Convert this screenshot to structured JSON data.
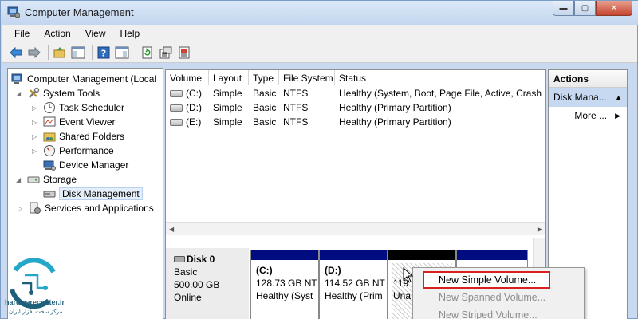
{
  "window": {
    "title": "Computer Management",
    "controls": [
      "minimize",
      "maximize",
      "close"
    ]
  },
  "menu": [
    "File",
    "Action",
    "View",
    "Help"
  ],
  "toolbar_icons": [
    "back-arrow-icon",
    "forward-arrow-icon",
    "up-folder-icon",
    "show-hide-tree-icon",
    "help-icon",
    "show-hide-action-pane-icon",
    "refresh-icon",
    "properties-icon",
    "export-list-icon"
  ],
  "tree": {
    "root": "Computer Management (Local",
    "items": [
      {
        "label": "System Tools",
        "icon": "tools-icon"
      },
      {
        "label": "Task Scheduler",
        "icon": "clock-icon"
      },
      {
        "label": "Event Viewer",
        "icon": "event-viewer-icon"
      },
      {
        "label": "Shared Folders",
        "icon": "shared-folder-icon"
      },
      {
        "label": "Performance",
        "icon": "performance-icon"
      },
      {
        "label": "Device Manager",
        "icon": "device-manager-icon"
      },
      {
        "label": "Storage",
        "icon": "storage-icon"
      },
      {
        "label": "Disk Management",
        "icon": "disk-management-icon"
      },
      {
        "label": "Services and Applications",
        "icon": "services-icon"
      }
    ]
  },
  "volumes": {
    "columns": [
      "Volume",
      "Layout",
      "Type",
      "File System",
      "Status"
    ],
    "rows": [
      [
        "(C:)",
        "Simple",
        "Basic",
        "NTFS",
        "Healthy (System, Boot, Page File, Active, Crash D"
      ],
      [
        "(D:)",
        "Simple",
        "Basic",
        "NTFS",
        "Healthy (Primary Partition)"
      ],
      [
        "(E:)",
        "Simple",
        "Basic",
        "NTFS",
        "Healthy (Primary Partition)"
      ]
    ]
  },
  "disk": {
    "name": "Disk 0",
    "type": "Basic",
    "size": "500.00 GB",
    "status": "Online",
    "partitions": [
      {
        "name": "(C:)",
        "size": "128.73 GB NT",
        "status": "Healthy (Syst"
      },
      {
        "name": "(D:)",
        "size": "114.52 GB NT",
        "status": "Healthy (Prim"
      },
      {
        "name": "",
        "size": "119",
        "status": "Una"
      },
      {
        "name": "",
        "size": "",
        "status": ""
      }
    ]
  },
  "actions": {
    "header": "Actions",
    "section": "Disk Mana...",
    "more": "More ..."
  },
  "context_menu": {
    "items": [
      "New Simple Volume...",
      "New Spanned Volume...",
      "New Striped Volume..."
    ]
  },
  "watermark": {
    "site": "hardwarecenter.ir",
    "tagline": "مرکز سخت افزار ایران"
  },
  "colors": {
    "partition_bar": "#000c7f",
    "unallocated_bar": "#000000",
    "highlight": "#d82020",
    "actions_section": "#c7d9f1"
  }
}
